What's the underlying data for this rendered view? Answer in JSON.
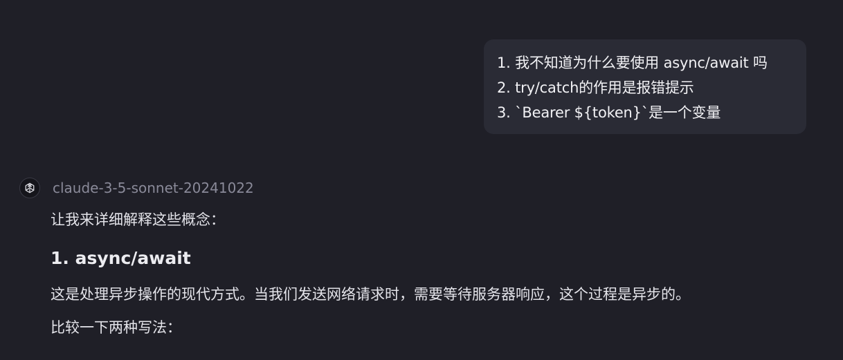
{
  "user_message": {
    "lines": [
      "1. 我不知道为什么要使用 async/await 吗",
      "2. try/catch的作用是报错提示",
      "3. `Bearer ${token}`是一个变量"
    ]
  },
  "assistant": {
    "model_icon": "openai-logo-icon",
    "model_name": "claude-3-5-sonnet-20241022",
    "intro": "让我来详细解释这些概念：",
    "heading": "1. async/await",
    "paragraph": "这是处理异步操作的现代方式。当我们发送网络请求时，需要等待服务器响应，这个过程是异步的。",
    "compare": "比较一下两种写法："
  },
  "colors": {
    "background": "#1f1f27",
    "bubble": "#2a2b35",
    "muted_text": "#8a8a99"
  }
}
